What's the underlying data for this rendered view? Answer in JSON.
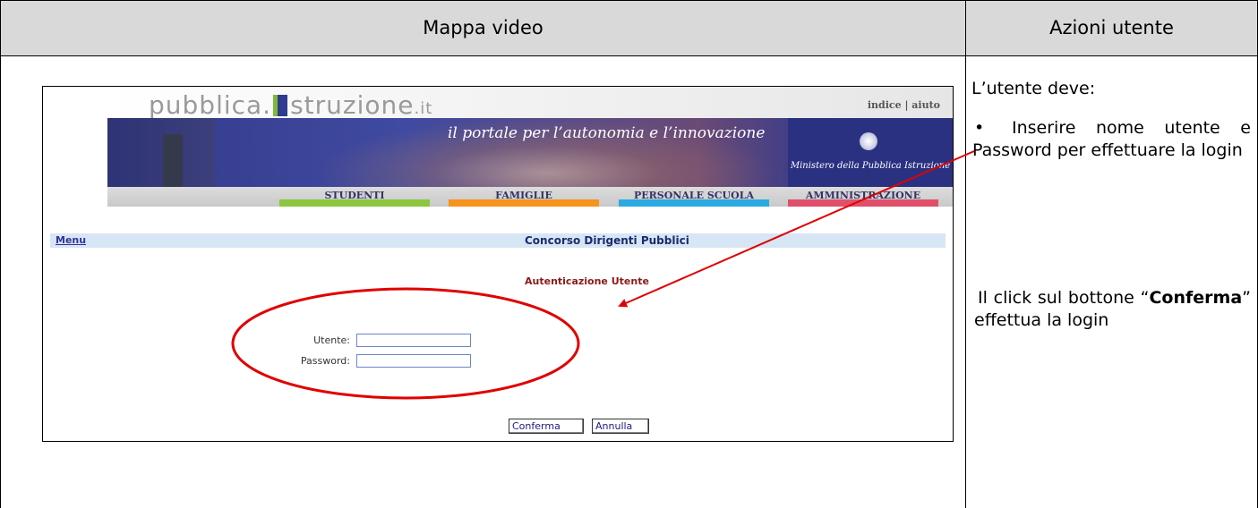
{
  "table": {
    "col1_header": "Mappa video",
    "col2_header": "Azioni utente"
  },
  "actions": {
    "intro": "L’utente deve:",
    "bullet_glyph": "•",
    "bullet_text": "Inserire nome utente e Password per effettuare la login",
    "click_prefix": "Il click sul bottone “",
    "click_button": "Conferma",
    "click_suffix": "” effettua la login"
  },
  "screenshot": {
    "logo_main": "pubblica.",
    "logo_word": "struzione",
    "logo_suffix": ".it",
    "top_links": "indice | aiuto",
    "tagline": "il portale per l’autonomia e l’innovazione",
    "ministero": "Ministero della Pubblica Istruzione",
    "nav": [
      {
        "label": "STUDENTI",
        "color": "#8cc63f"
      },
      {
        "label": "FAMIGLIE",
        "color": "#f7941d"
      },
      {
        "label": "PERSONALE SCUOLA",
        "color": "#29abe2"
      },
      {
        "label": "AMMINISTRAZIONE",
        "color": "#e0506b"
      }
    ],
    "menu_link": "Menu",
    "page_title": "Concorso Dirigenti Pubblici",
    "auth_title": "Autenticazione Utente",
    "user_label": "Utente:",
    "password_label": "Password:",
    "user_value": "",
    "password_value": "",
    "confirm_button": "Conferma",
    "cancel_button": "Annulla"
  },
  "colors": {
    "header_bg": "#d9d9d9",
    "annotation": "#e00000",
    "menubar": "#d6e6f5"
  }
}
